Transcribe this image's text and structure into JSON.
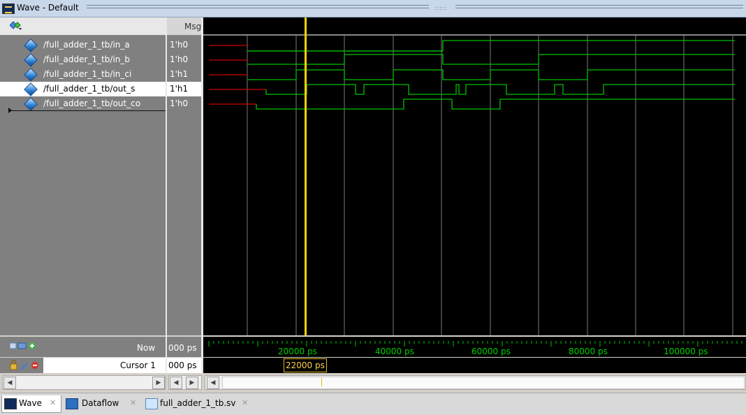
{
  "window": {
    "title": "Wave - Default"
  },
  "header": {
    "msgs_label": "Msgs"
  },
  "signals": [
    {
      "name": "/full_adder_1_tb/in_a",
      "value": "1'h0"
    },
    {
      "name": "/full_adder_1_tb/in_b",
      "value": "1'h0"
    },
    {
      "name": "/full_adder_1_tb/in_ci",
      "value": "1'h1"
    },
    {
      "name": "/full_adder_1_tb/out_s",
      "value": "1'h1"
    },
    {
      "name": "/full_adder_1_tb/out_co",
      "value": "1'h0"
    }
  ],
  "timeline": {
    "now_label": "Now",
    "now_value": "000 ps",
    "cursor_label": "Cursor 1",
    "cursor_value": "000 ps",
    "cursor_time": "22000 ps",
    "tick_labels": [
      "20000 ps",
      "40000 ps",
      "60000 ps",
      "80000 ps",
      "100000 ps"
    ]
  },
  "tabs": [
    {
      "label": "Wave",
      "icon": "wave-icon"
    },
    {
      "label": "Dataflow",
      "icon": "dataflow-icon"
    },
    {
      "label": "full_adder_1_tb.sv",
      "icon": "file-icon"
    }
  ],
  "colors": {
    "wave": "#00c000",
    "cursor": "#ffd000",
    "unknown": "#d00000",
    "grid": "#7a7a7a"
  }
}
